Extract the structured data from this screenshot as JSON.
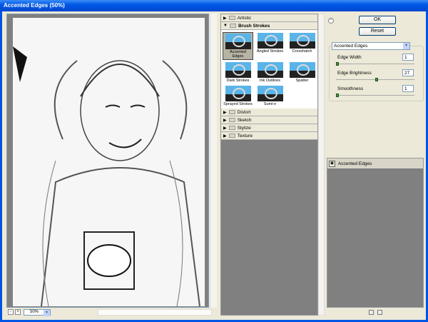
{
  "window": {
    "title": "Accented Edges (50%)"
  },
  "preview": {
    "zoom": "50%",
    "zoom_out": "-",
    "zoom_in": "+"
  },
  "gallery": {
    "categories": [
      {
        "label": "Artistic",
        "expanded": false
      },
      {
        "label": "Brush Strokes",
        "expanded": true
      },
      {
        "label": "Distort",
        "expanded": false
      },
      {
        "label": "Sketch",
        "expanded": false
      },
      {
        "label": "Stylize",
        "expanded": false
      },
      {
        "label": "Texture",
        "expanded": false
      }
    ],
    "brush_strokes": [
      "Accented Edges",
      "Angled Strokes",
      "Crosshatch",
      "Dark Strokes",
      "Ink Outlines",
      "Spatter",
      "Sprayed Strokes",
      "Sumi-e"
    ],
    "selected": "Accented Edges"
  },
  "buttons": {
    "ok": "OK",
    "reset": "Reset"
  },
  "filter_select": {
    "value": "Accented Edges"
  },
  "params": [
    {
      "label": "Edge Width",
      "value": "1",
      "fraction": 0.0
    },
    {
      "label": "Edge Brightness",
      "value": "27",
      "fraction": 0.52
    },
    {
      "label": "Smoothness",
      "value": "1",
      "fraction": 0.0
    }
  ],
  "layers": {
    "items": [
      "Accented Edges"
    ]
  }
}
